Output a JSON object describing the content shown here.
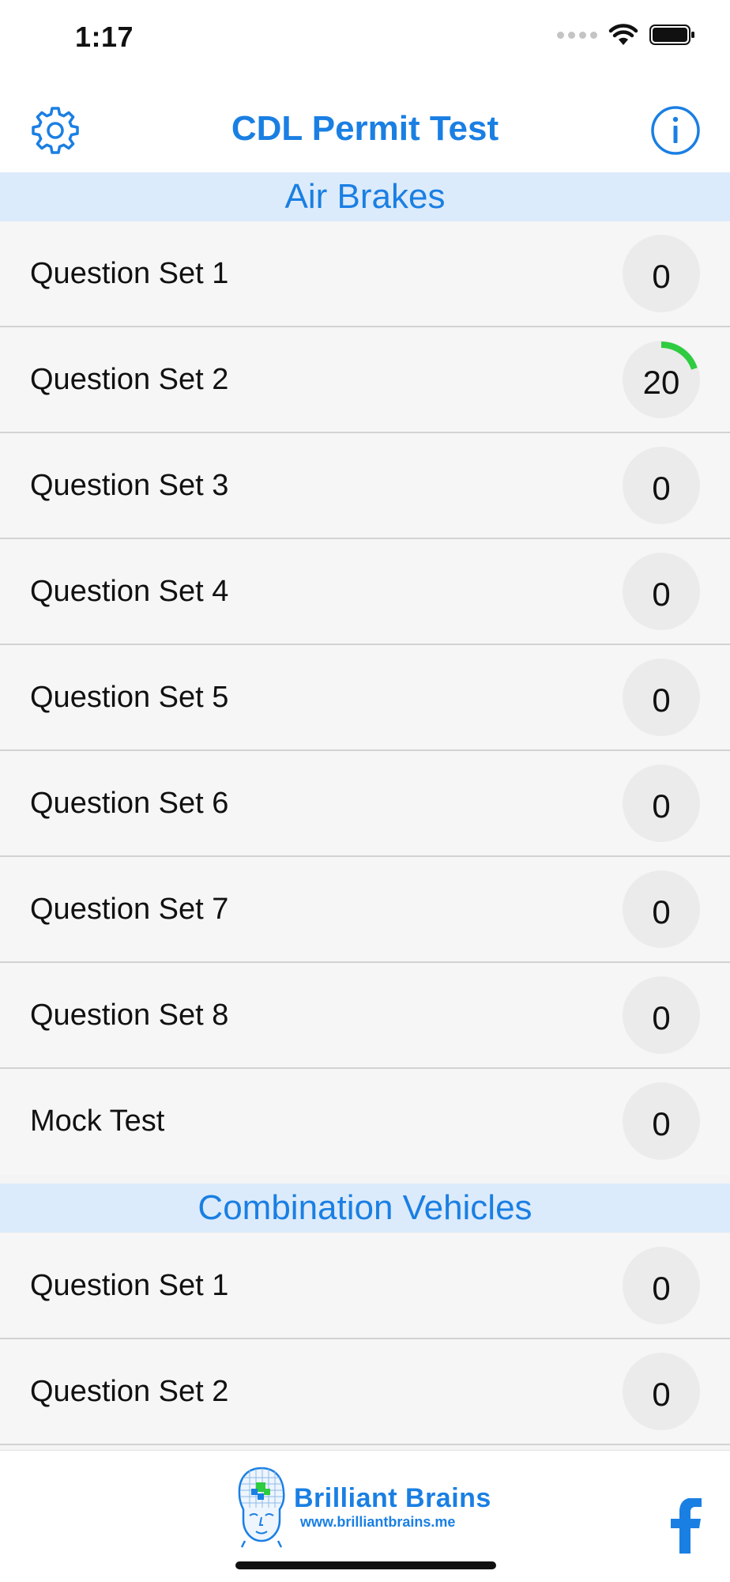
{
  "status_bar": {
    "time": "1:17"
  },
  "nav": {
    "title": "CDL Permit Test"
  },
  "sections": [
    {
      "title": "Air Brakes",
      "items": [
        {
          "label": "Question Set 1",
          "score": "0",
          "progress": 0
        },
        {
          "label": "Question Set 2",
          "score": "20",
          "progress": 0.2
        },
        {
          "label": "Question Set 3",
          "score": "0",
          "progress": 0
        },
        {
          "label": "Question Set 4",
          "score": "0",
          "progress": 0
        },
        {
          "label": "Question Set 5",
          "score": "0",
          "progress": 0
        },
        {
          "label": "Question Set 6",
          "score": "0",
          "progress": 0
        },
        {
          "label": "Question Set 7",
          "score": "0",
          "progress": 0
        },
        {
          "label": "Question Set 8",
          "score": "0",
          "progress": 0
        },
        {
          "label": "Mock Test",
          "score": "0",
          "progress": 0
        }
      ]
    },
    {
      "title": "Combination Vehicles",
      "items": [
        {
          "label": "Question Set 1",
          "score": "0",
          "progress": 0
        },
        {
          "label": "Question Set 2",
          "score": "0",
          "progress": 0
        }
      ]
    }
  ],
  "footer": {
    "logo_name": "Brilliant Brains",
    "logo_url": "www.brilliantbrains.me"
  },
  "icons": {
    "settings": "gear-icon",
    "info": "info-icon",
    "facebook": "facebook-icon",
    "wifi": "wifi-icon",
    "battery": "battery-icon",
    "logo": "brain-head-logo"
  },
  "colors": {
    "accent": "#1a7fe3",
    "section_bg": "#dcebfb",
    "progress": "#2ecc40"
  }
}
